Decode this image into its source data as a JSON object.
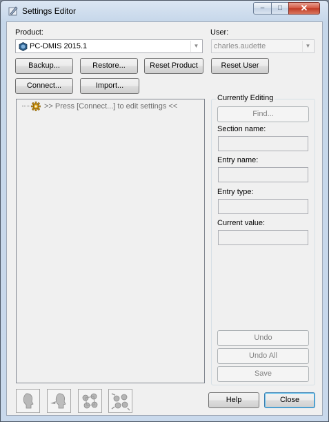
{
  "window": {
    "title": "Settings Editor",
    "controls": {
      "minimize": "–",
      "maximize": "□",
      "close": "✕"
    }
  },
  "product": {
    "label": "Product:",
    "selected": "PC-DMIS 2015.1",
    "icon": "product-globe-icon"
  },
  "user": {
    "label": "User:",
    "selected": "charles.audette"
  },
  "buttons": {
    "backup": "Backup...",
    "restore": "Restore...",
    "reset_product": "Reset Product",
    "reset_user": "Reset User",
    "connect": "Connect...",
    "import": "Import..."
  },
  "tree": {
    "items": [
      {
        "label": ">> Press [Connect...] to edit settings <<",
        "icon": "settings-gear-icon"
      }
    ]
  },
  "editing": {
    "title": "Currently Editing",
    "find": "Find...",
    "section_label": "Section name:",
    "section_value": "",
    "entry_label": "Entry name:",
    "entry_value": "",
    "type_label": "Entry type:",
    "type_value": "",
    "current_label": "Current value:",
    "current_value": "",
    "undo": "Undo",
    "undo_all": "Undo All",
    "save": "Save"
  },
  "footer": {
    "help": "Help",
    "close": "Close",
    "thumbnails": [
      "head-profile-icon",
      "head-arrow-icon",
      "molecule-icon",
      "molecule-arrows-icon"
    ]
  },
  "colors": {
    "title_gradient_top": "#dbe6f3",
    "close_button": "#c03a24",
    "client_bg": "#f0f0f0",
    "disabled_text": "#838383"
  }
}
